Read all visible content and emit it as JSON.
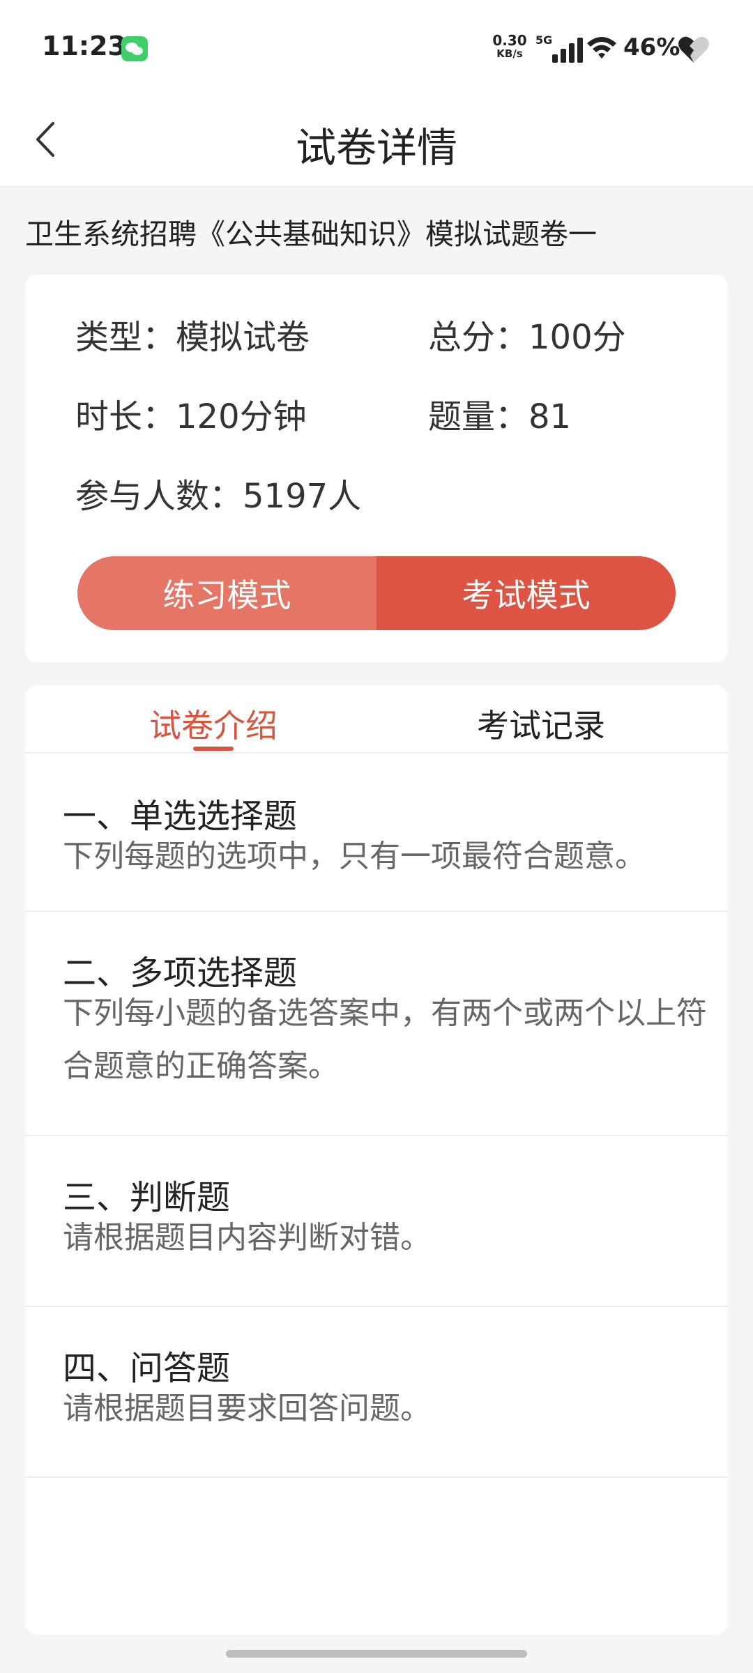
{
  "status_bar": {
    "time": "11:23",
    "net_speed_value": "0.30",
    "net_speed_unit": "KB/s",
    "network_type": "5G",
    "battery": "46%"
  },
  "header": {
    "title": "试卷详情"
  },
  "exam": {
    "title": "卫生系统招聘《公共基础知识》模拟试题卷一",
    "type": "类型：模拟试卷",
    "total_score": "总分：100分",
    "duration": "时长：120分钟",
    "question_count": "题量：81",
    "participants": "参与人数：5197人"
  },
  "modes": {
    "practice": "练习模式",
    "exam": "考试模式"
  },
  "tabs": {
    "intro": "试卷介绍",
    "record": "考试记录"
  },
  "sections": [
    {
      "title": "一、单选选择题",
      "desc": "下列每题的选项中，只有一项最符合题意。"
    },
    {
      "title": "二、多项选择题",
      "desc": "下列每小题的备选答案中，有两个或两个以上符合题意的正确答案。"
    },
    {
      "title": "三、判断题",
      "desc": "请根据题目内容判断对错。"
    },
    {
      "title": "四、问答题",
      "desc": "请根据题目要求回答问题。"
    }
  ],
  "colors": {
    "accent": "#d9533f",
    "practice_button": "#e57564",
    "exam_button": "#dd5442"
  }
}
